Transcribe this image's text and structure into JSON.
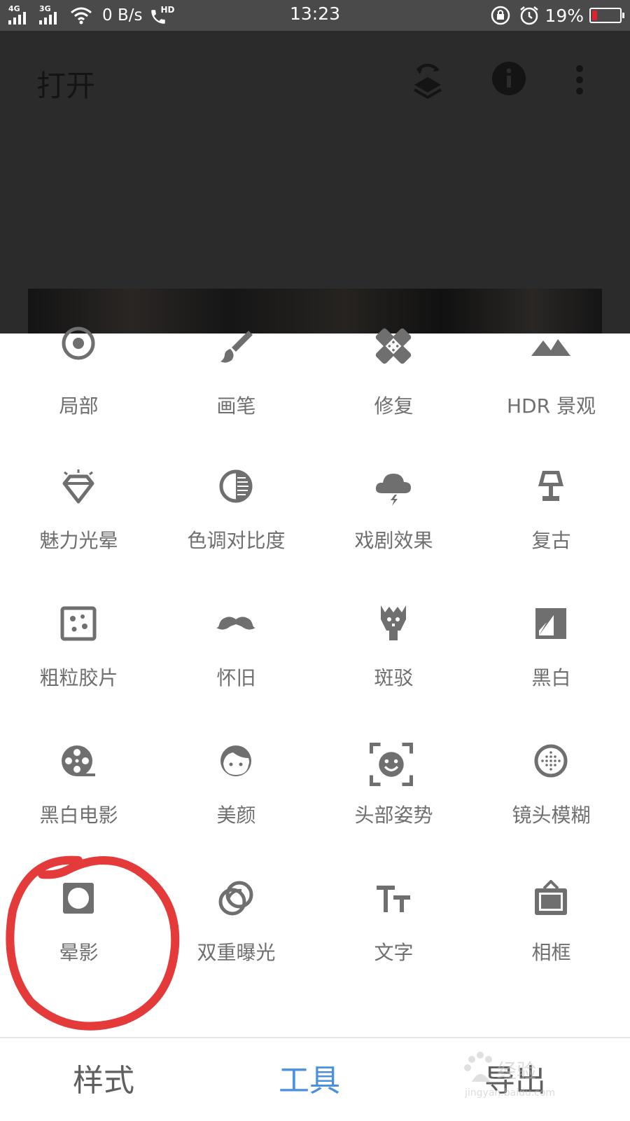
{
  "status_bar": {
    "network_1": "4G",
    "network_2": "3G",
    "speed": "0 B/s",
    "call_badge": "HD",
    "time": "13:23",
    "battery_percent": "19%",
    "battery_level": 0.19,
    "battery_color": "#e0202a"
  },
  "header": {
    "title": "打开",
    "icons": [
      "layers-undo-icon",
      "info-icon",
      "more-vert-icon"
    ]
  },
  "tools": [
    {
      "label": "局部",
      "icon": "selective-icon"
    },
    {
      "label": "画笔",
      "icon": "brush-icon"
    },
    {
      "label": "修复",
      "icon": "healing-icon"
    },
    {
      "label": "HDR 景观",
      "icon": "hdr-scape-icon"
    },
    {
      "label": "魅力光晕",
      "icon": "glamour-glow-icon"
    },
    {
      "label": "色调对比度",
      "icon": "tonal-contrast-icon"
    },
    {
      "label": "戏剧效果",
      "icon": "drama-icon"
    },
    {
      "label": "复古",
      "icon": "vintage-icon"
    },
    {
      "label": "粗粒胶片",
      "icon": "grainy-film-icon"
    },
    {
      "label": "怀旧",
      "icon": "retrolux-icon"
    },
    {
      "label": "斑驳",
      "icon": "grunge-icon"
    },
    {
      "label": "黑白",
      "icon": "black-white-icon"
    },
    {
      "label": "黑白电影",
      "icon": "noir-icon"
    },
    {
      "label": "美颜",
      "icon": "portrait-icon"
    },
    {
      "label": "头部姿势",
      "icon": "head-pose-icon"
    },
    {
      "label": "镜头模糊",
      "icon": "lens-blur-icon"
    },
    {
      "label": "晕影",
      "icon": "vignette-icon"
    },
    {
      "label": "双重曝光",
      "icon": "double-exposure-icon"
    },
    {
      "label": "文字",
      "icon": "text-icon"
    },
    {
      "label": "相框",
      "icon": "frames-icon"
    }
  ],
  "annotation": {
    "color": "#e53a3a",
    "target": "晕影"
  },
  "bottom_nav": {
    "tabs": [
      {
        "label": "样式",
        "active": false
      },
      {
        "label": "工具",
        "active": true
      },
      {
        "label": "导出",
        "active": false
      }
    ],
    "active_color": "#4a8fe0"
  },
  "watermark": {
    "text": "Baidu经验",
    "sub": "jingyan.baidu.com"
  },
  "colors": {
    "icon": "#6f6f6f",
    "dark_bg": "#2b2b2b"
  }
}
